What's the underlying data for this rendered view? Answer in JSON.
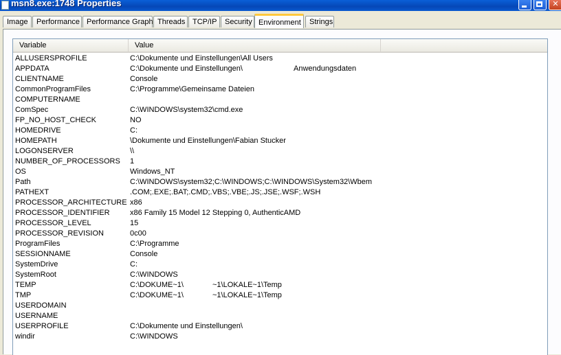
{
  "window": {
    "title": "msn8.exe:1748 Properties"
  },
  "tabs": [
    {
      "label": "Image"
    },
    {
      "label": "Performance"
    },
    {
      "label": "Performance Graph"
    },
    {
      "label": "Threads"
    },
    {
      "label": "TCP/IP"
    },
    {
      "label": "Security"
    },
    {
      "label": "Environment",
      "active": true
    },
    {
      "label": "Strings"
    }
  ],
  "table": {
    "columns": [
      "Variable",
      "Value"
    ],
    "rows": [
      {
        "variable": "ALLUSERSPROFILE",
        "value": "C:\\Dokumente und Einstellungen\\All Users",
        "value_part2": ""
      },
      {
        "variable": "APPDATA",
        "value": "C:\\Dokumente und Einstellungen\\",
        "value_part2": "Anwendungsdaten"
      },
      {
        "variable": "CLIENTNAME",
        "value": "Console",
        "value_part2": ""
      },
      {
        "variable": "CommonProgramFiles",
        "value": "C:\\Programme\\Gemeinsame Dateien",
        "value_part2": ""
      },
      {
        "variable": "COMPUTERNAME",
        "value": "",
        "value_part2": ""
      },
      {
        "variable": "ComSpec",
        "value": "C:\\WINDOWS\\system32\\cmd.exe",
        "value_part2": ""
      },
      {
        "variable": "FP_NO_HOST_CHECK",
        "value": "NO",
        "value_part2": ""
      },
      {
        "variable": "HOMEDRIVE",
        "value": "C:",
        "value_part2": ""
      },
      {
        "variable": "HOMEPATH",
        "value": "\\Dokumente und Einstellungen\\Fabian Stucker",
        "value_part2": ""
      },
      {
        "variable": "LOGONSERVER",
        "value": "\\\\",
        "value_part2": ""
      },
      {
        "variable": "NUMBER_OF_PROCESSORS",
        "value": "1",
        "value_part2": ""
      },
      {
        "variable": "OS",
        "value": "Windows_NT",
        "value_part2": ""
      },
      {
        "variable": "Path",
        "value": "C:\\WINDOWS\\system32;C:\\WINDOWS;C:\\WINDOWS\\System32\\Wbem",
        "value_part2": ""
      },
      {
        "variable": "PATHEXT",
        "value": ".COM;.EXE;.BAT;.CMD;.VBS;.VBE;.JS;.JSE;.WSF;.WSH",
        "value_part2": ""
      },
      {
        "variable": "PROCESSOR_ARCHITECTURE",
        "value": "x86",
        "value_part2": ""
      },
      {
        "variable": "PROCESSOR_IDENTIFIER",
        "value": "x86 Family 15 Model 12 Stepping 0, AuthenticAMD",
        "value_part2": ""
      },
      {
        "variable": "PROCESSOR_LEVEL",
        "value": "15",
        "value_part2": ""
      },
      {
        "variable": "PROCESSOR_REVISION",
        "value": "0c00",
        "value_part2": ""
      },
      {
        "variable": "ProgramFiles",
        "value": "C:\\Programme",
        "value_part2": ""
      },
      {
        "variable": "SESSIONNAME",
        "value": "Console",
        "value_part2": ""
      },
      {
        "variable": "SystemDrive",
        "value": "C:",
        "value_part2": ""
      },
      {
        "variable": "SystemRoot",
        "value": "C:\\WINDOWS",
        "value_part2": ""
      },
      {
        "variable": "TEMP",
        "value": "C:\\DOKUME~1\\",
        "value_part2": "~1\\LOKALE~1\\Temp"
      },
      {
        "variable": "TMP",
        "value": "C:\\DOKUME~1\\",
        "value_part2": "~1\\LOKALE~1\\Temp"
      },
      {
        "variable": "USERDOMAIN",
        "value": "",
        "value_part2": ""
      },
      {
        "variable": "USERNAME",
        "value": "",
        "value_part2": ""
      },
      {
        "variable": "USERPROFILE",
        "value": "C:\\Dokumente und Einstellungen\\",
        "value_part2": ""
      },
      {
        "variable": "windir",
        "value": "C:\\WINDOWS",
        "value_part2": ""
      }
    ]
  }
}
